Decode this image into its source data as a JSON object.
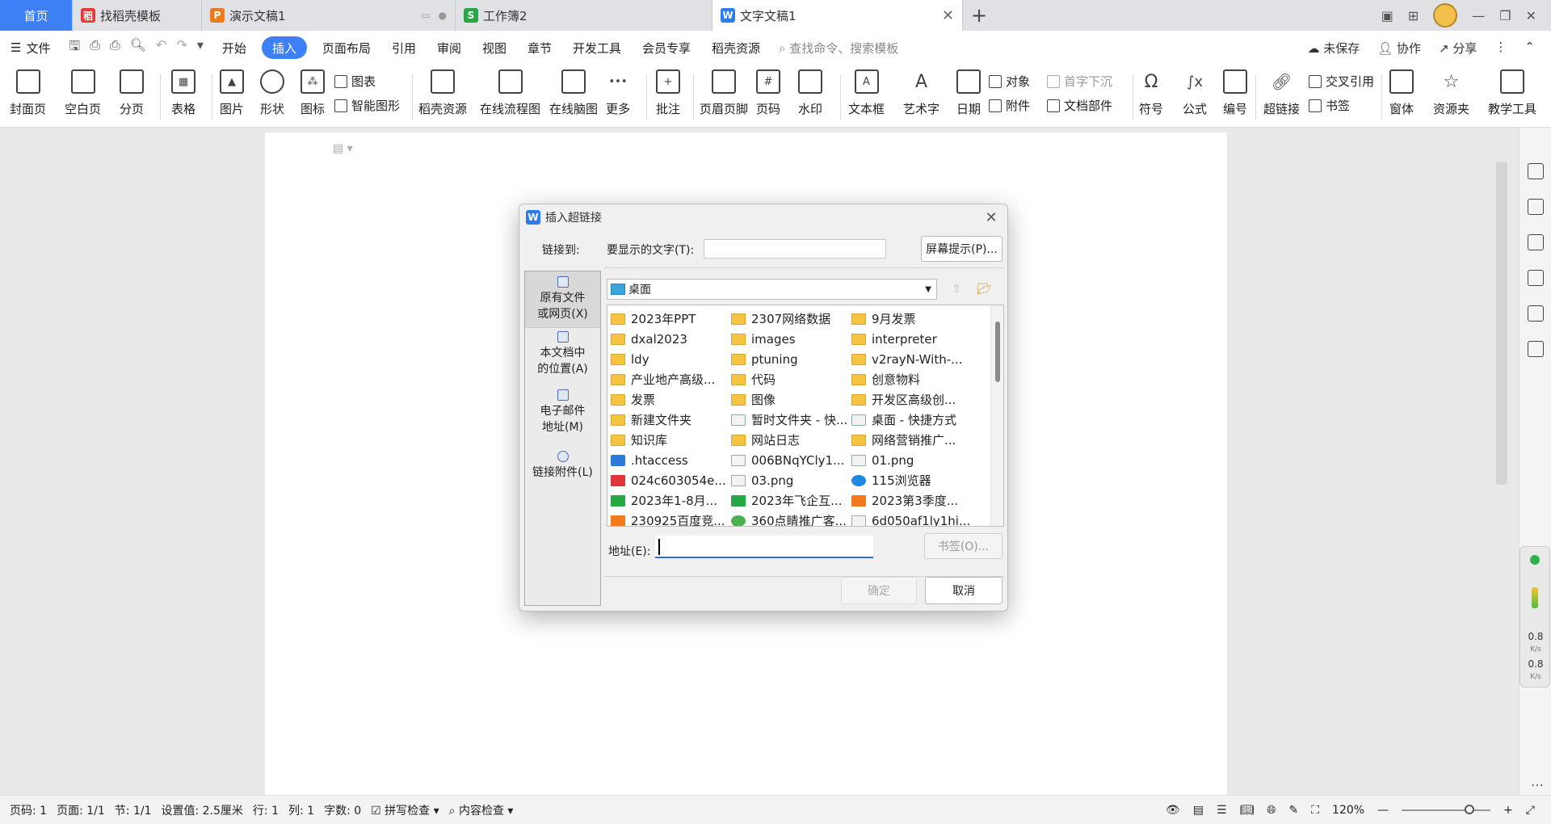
{
  "tabs": [
    {
      "label": "首页",
      "icon": "home"
    },
    {
      "label": "找稻壳模板",
      "icon": "docer-icon"
    },
    {
      "label": "演示文稿1",
      "icon": "ppt-icon"
    },
    {
      "label": "工作簿2",
      "icon": "sheet-icon"
    },
    {
      "label": "文字文稿1",
      "icon": "writer-icon"
    }
  ],
  "menu": {
    "file": "文件",
    "items": [
      "开始",
      "插入",
      "页面布局",
      "引用",
      "审阅",
      "视图",
      "章节",
      "开发工具",
      "会员专享",
      "稻壳资源"
    ],
    "search": "查找命令、搜索模板",
    "unsaved": "未保存",
    "collab": "协作",
    "share": "分享"
  },
  "ribbon": {
    "cover": "封面页",
    "blank": "空白页",
    "pagebreak": "分页",
    "table": "表格",
    "picture": "图片",
    "shape": "形状",
    "icon": "图标",
    "chart": "图表",
    "smartart": "智能图形",
    "docer": "稻壳资源",
    "flow": "在线流程图",
    "mind": "在线脑图",
    "more": "更多",
    "comment": "批注",
    "header": "页眉页脚",
    "pagenum": "页码",
    "watermark": "水印",
    "textbox": "文本框",
    "arttext": "艺术字",
    "date": "日期",
    "object": "对象",
    "dropcap": "首字下沉",
    "attach": "附件",
    "docpart": "文档部件",
    "symbol": "符号",
    "formula": "公式",
    "number": "编号",
    "hyperlink": "超链接",
    "crossref": "交叉引用",
    "bookmark": "书签",
    "window": "窗体",
    "resfolder": "资源夹",
    "teach": "教学工具"
  },
  "dialog": {
    "title": "插入超链接",
    "link_to": "链接到:",
    "display_text_label": "要显示的文字(T):",
    "display_text_value": "",
    "screen_tip": "屏幕提示(P)...",
    "left_items": [
      "原有文件\n或网页(X)",
      "本文档中\n的位置(A)",
      "电子邮件\n地址(M)",
      "链接附件(L)"
    ],
    "location": "桌面",
    "files": [
      {
        "name": "2023年PPT",
        "type": "folder"
      },
      {
        "name": "2307网络数据",
        "type": "folder"
      },
      {
        "name": "9月发票",
        "type": "folder"
      },
      {
        "name": "dxal2023",
        "type": "folder"
      },
      {
        "name": "images",
        "type": "folder"
      },
      {
        "name": "interpreter",
        "type": "folder"
      },
      {
        "name": "ldy",
        "type": "folder"
      },
      {
        "name": "ptuning",
        "type": "folder"
      },
      {
        "name": "v2rayN-With-...",
        "type": "folder"
      },
      {
        "name": "产业地产高级...",
        "type": "folder"
      },
      {
        "name": "代码",
        "type": "folder"
      },
      {
        "name": "创意物料",
        "type": "folder"
      },
      {
        "name": "发票",
        "type": "folder"
      },
      {
        "name": "图像",
        "type": "folder"
      },
      {
        "name": "开发区高级创...",
        "type": "folder"
      },
      {
        "name": "新建文件夹",
        "type": "folder"
      },
      {
        "name": "暂时文件夹 - 快...",
        "type": "sc"
      },
      {
        "name": "桌面 - 快捷方式",
        "type": "sc"
      },
      {
        "name": "知识库",
        "type": "folder"
      },
      {
        "name": "网站日志",
        "type": "folder"
      },
      {
        "name": "网络营销推广...",
        "type": "folder"
      },
      {
        "name": ".htaccess",
        "type": "vs"
      },
      {
        "name": "006BNqYCly1...",
        "type": "png"
      },
      {
        "name": "01.png",
        "type": "png"
      },
      {
        "name": "024c603054e...",
        "type": "pdf"
      },
      {
        "name": "03.png",
        "type": "png"
      },
      {
        "name": "115浏览器",
        "type": "app"
      },
      {
        "name": "2023年1-8月...",
        "type": "xls"
      },
      {
        "name": "2023年飞企互...",
        "type": "xls"
      },
      {
        "name": "2023第3季度...",
        "type": "ppt"
      },
      {
        "name": "230925百度竞...",
        "type": "ppt"
      },
      {
        "name": "360点睛推广客...",
        "type": "app2"
      },
      {
        "name": "6d050af1ly1hi...",
        "type": "png"
      }
    ],
    "address_label": "地址(E):",
    "address_value": "",
    "bookmark_btn": "书签(O)...",
    "ok": "确定",
    "cancel": "取消"
  },
  "status": {
    "page": "页码: 1",
    "pages": "页面: 1/1",
    "section": "节: 1/1",
    "setting": "设置值: 2.5厘米",
    "row": "行: 1",
    "col": "列: 1",
    "words": "字数: 0",
    "spell": "拼写检查",
    "content": "内容检查",
    "zoom": "120%"
  },
  "net": {
    "up": "0.8",
    "down": "0.8",
    "unit": "K/s"
  }
}
